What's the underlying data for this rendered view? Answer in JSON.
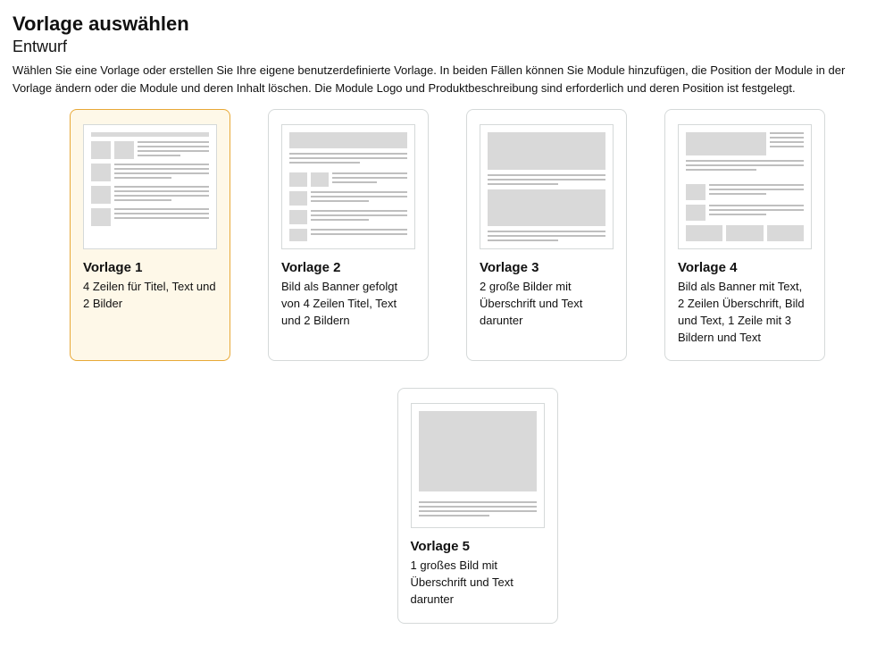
{
  "header": {
    "title": "Vorlage auswählen",
    "subtitle": "Entwurf",
    "description": "Wählen Sie eine Vorlage oder erstellen Sie Ihre eigene benutzerdefinierte Vorlage. In beiden Fällen können Sie Module hinzufügen, die Position der Module in der Vorlage ändern oder die Module und deren Inhalt löschen. Die Module Logo und Produktbeschreibung sind erforderlich und deren Position ist festgelegt."
  },
  "templates": [
    {
      "title": "Vorlage 1",
      "desc": "4 Zeilen für Titel, Text und 2 Bilder",
      "selected": true
    },
    {
      "title": "Vorlage 2",
      "desc": "Bild als Banner gefolgt von 4 Zeilen Titel, Text und 2 Bildern",
      "selected": false
    },
    {
      "title": "Vorlage 3",
      "desc": "2 große Bilder mit Überschrift und Text darunter",
      "selected": false
    },
    {
      "title": "Vorlage 4",
      "desc": "Bild als Banner mit Text, 2 Zeilen Überschrift, Bild und Text, 1 Zeile mit 3 Bildern und Text",
      "selected": false
    },
    {
      "title": "Vorlage 5",
      "desc": "1 großes Bild mit Überschrift und Text darunter",
      "selected": false
    }
  ]
}
